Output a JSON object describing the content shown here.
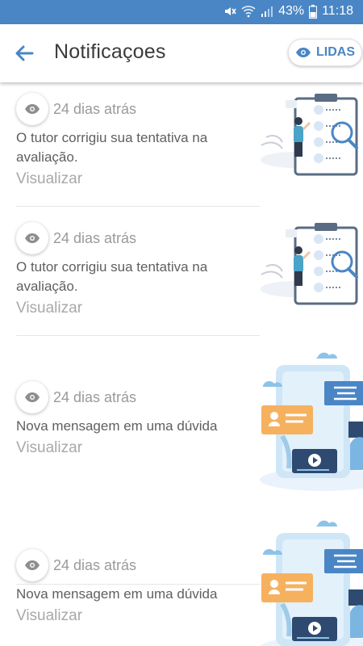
{
  "status": {
    "battery_pct": "43%",
    "time": "11:18"
  },
  "header": {
    "title": "Notificaçoes",
    "lidas_label": "LIDAS"
  },
  "icons": {
    "back": "arrow-left-icon",
    "eye": "eye-icon",
    "illustration_a": "clipboard-review-illustration",
    "illustration_b": "phone-chat-illustration"
  },
  "colors": {
    "accent": "#4a86c5",
    "statusbar": "#4a86c5"
  },
  "notifications": [
    {
      "time": "24 dias atrás",
      "message": "O tutor corrigiu sua tentativa na avaliação.",
      "action": "Visualizar"
    },
    {
      "time": "24 dias atrás",
      "message": "O tutor corrigiu sua tentativa na avaliação.",
      "action": "Visualizar"
    },
    {
      "time": "24 dias atrás",
      "message": "Nova mensagem em uma dúvida",
      "action": "Visualizar"
    },
    {
      "time": "24 dias atrás",
      "message": "Nova mensagem em uma dúvida",
      "action": "Visualizar"
    }
  ]
}
